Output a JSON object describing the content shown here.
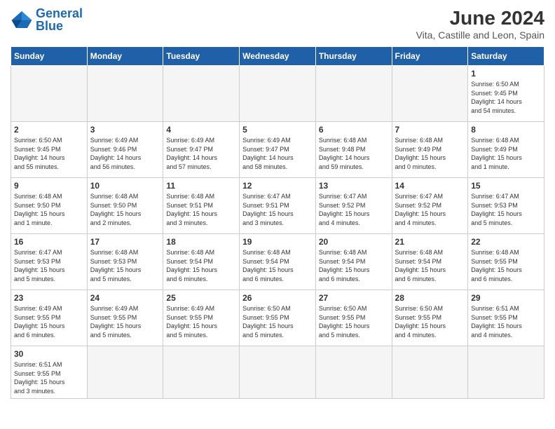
{
  "header": {
    "logo_general": "General",
    "logo_blue": "Blue",
    "title": "June 2024",
    "subtitle": "Vita, Castille and Leon, Spain"
  },
  "days_of_week": [
    "Sunday",
    "Monday",
    "Tuesday",
    "Wednesday",
    "Thursday",
    "Friday",
    "Saturday"
  ],
  "weeks": [
    [
      {
        "day": "",
        "info": ""
      },
      {
        "day": "",
        "info": ""
      },
      {
        "day": "",
        "info": ""
      },
      {
        "day": "",
        "info": ""
      },
      {
        "day": "",
        "info": ""
      },
      {
        "day": "",
        "info": ""
      },
      {
        "day": "1",
        "info": "Sunrise: 6:50 AM\nSunset: 9:45 PM\nDaylight: 14 hours\nand 54 minutes."
      }
    ],
    [
      {
        "day": "2",
        "info": "Sunrise: 6:50 AM\nSunset: 9:45 PM\nDaylight: 14 hours\nand 55 minutes."
      },
      {
        "day": "3",
        "info": "Sunrise: 6:49 AM\nSunset: 9:46 PM\nDaylight: 14 hours\nand 56 minutes."
      },
      {
        "day": "4",
        "info": "Sunrise: 6:49 AM\nSunset: 9:47 PM\nDaylight: 14 hours\nand 57 minutes."
      },
      {
        "day": "5",
        "info": "Sunrise: 6:49 AM\nSunset: 9:47 PM\nDaylight: 14 hours\nand 58 minutes."
      },
      {
        "day": "6",
        "info": "Sunrise: 6:48 AM\nSunset: 9:48 PM\nDaylight: 14 hours\nand 59 minutes."
      },
      {
        "day": "7",
        "info": "Sunrise: 6:48 AM\nSunset: 9:49 PM\nDaylight: 15 hours\nand 0 minutes."
      },
      {
        "day": "8",
        "info": "Sunrise: 6:48 AM\nSunset: 9:49 PM\nDaylight: 15 hours\nand 1 minute."
      }
    ],
    [
      {
        "day": "9",
        "info": "Sunrise: 6:48 AM\nSunset: 9:50 PM\nDaylight: 15 hours\nand 1 minute."
      },
      {
        "day": "10",
        "info": "Sunrise: 6:48 AM\nSunset: 9:50 PM\nDaylight: 15 hours\nand 2 minutes."
      },
      {
        "day": "11",
        "info": "Sunrise: 6:48 AM\nSunset: 9:51 PM\nDaylight: 15 hours\nand 3 minutes."
      },
      {
        "day": "12",
        "info": "Sunrise: 6:47 AM\nSunset: 9:51 PM\nDaylight: 15 hours\nand 3 minutes."
      },
      {
        "day": "13",
        "info": "Sunrise: 6:47 AM\nSunset: 9:52 PM\nDaylight: 15 hours\nand 4 minutes."
      },
      {
        "day": "14",
        "info": "Sunrise: 6:47 AM\nSunset: 9:52 PM\nDaylight: 15 hours\nand 4 minutes."
      },
      {
        "day": "15",
        "info": "Sunrise: 6:47 AM\nSunset: 9:53 PM\nDaylight: 15 hours\nand 5 minutes."
      }
    ],
    [
      {
        "day": "16",
        "info": "Sunrise: 6:47 AM\nSunset: 9:53 PM\nDaylight: 15 hours\nand 5 minutes."
      },
      {
        "day": "17",
        "info": "Sunrise: 6:48 AM\nSunset: 9:53 PM\nDaylight: 15 hours\nand 5 minutes."
      },
      {
        "day": "18",
        "info": "Sunrise: 6:48 AM\nSunset: 9:54 PM\nDaylight: 15 hours\nand 6 minutes."
      },
      {
        "day": "19",
        "info": "Sunrise: 6:48 AM\nSunset: 9:54 PM\nDaylight: 15 hours\nand 6 minutes."
      },
      {
        "day": "20",
        "info": "Sunrise: 6:48 AM\nSunset: 9:54 PM\nDaylight: 15 hours\nand 6 minutes."
      },
      {
        "day": "21",
        "info": "Sunrise: 6:48 AM\nSunset: 9:54 PM\nDaylight: 15 hours\nand 6 minutes."
      },
      {
        "day": "22",
        "info": "Sunrise: 6:48 AM\nSunset: 9:55 PM\nDaylight: 15 hours\nand 6 minutes."
      }
    ],
    [
      {
        "day": "23",
        "info": "Sunrise: 6:49 AM\nSunset: 9:55 PM\nDaylight: 15 hours\nand 6 minutes."
      },
      {
        "day": "24",
        "info": "Sunrise: 6:49 AM\nSunset: 9:55 PM\nDaylight: 15 hours\nand 5 minutes."
      },
      {
        "day": "25",
        "info": "Sunrise: 6:49 AM\nSunset: 9:55 PM\nDaylight: 15 hours\nand 5 minutes."
      },
      {
        "day": "26",
        "info": "Sunrise: 6:50 AM\nSunset: 9:55 PM\nDaylight: 15 hours\nand 5 minutes."
      },
      {
        "day": "27",
        "info": "Sunrise: 6:50 AM\nSunset: 9:55 PM\nDaylight: 15 hours\nand 5 minutes."
      },
      {
        "day": "28",
        "info": "Sunrise: 6:50 AM\nSunset: 9:55 PM\nDaylight: 15 hours\nand 4 minutes."
      },
      {
        "day": "29",
        "info": "Sunrise: 6:51 AM\nSunset: 9:55 PM\nDaylight: 15 hours\nand 4 minutes."
      }
    ],
    [
      {
        "day": "30",
        "info": "Sunrise: 6:51 AM\nSunset: 9:55 PM\nDaylight: 15 hours\nand 3 minutes."
      },
      {
        "day": "",
        "info": ""
      },
      {
        "day": "",
        "info": ""
      },
      {
        "day": "",
        "info": ""
      },
      {
        "day": "",
        "info": ""
      },
      {
        "day": "",
        "info": ""
      },
      {
        "day": "",
        "info": ""
      }
    ]
  ]
}
